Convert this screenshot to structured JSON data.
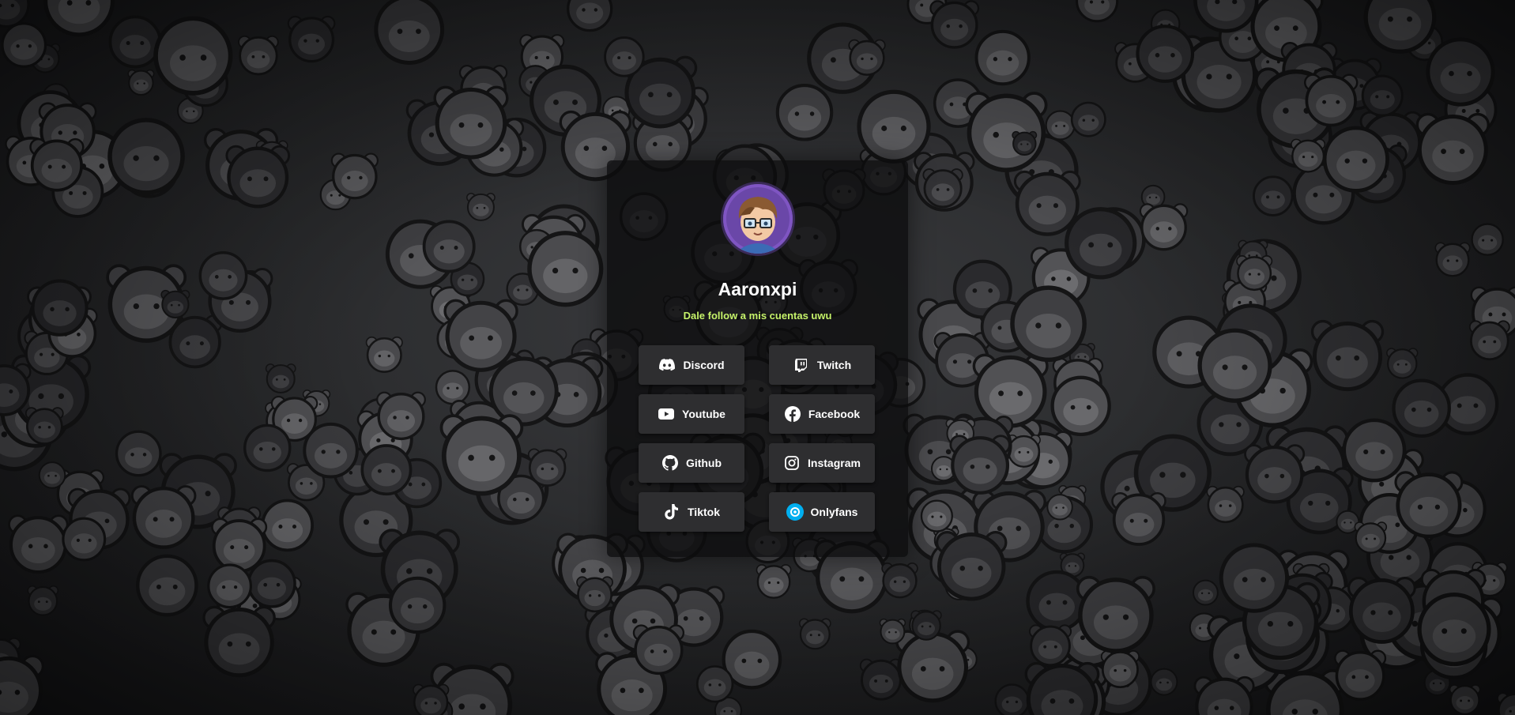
{
  "profile": {
    "name": "Aaronxpi",
    "tagline": "Dale follow a mis cuentas uwu",
    "avatar_icon": "avatar-cartoon-boy-glasses"
  },
  "links": [
    {
      "label": "Discord",
      "icon": "discord-icon"
    },
    {
      "label": "Twitch",
      "icon": "twitch-icon"
    },
    {
      "label": "Youtube",
      "icon": "youtube-icon"
    },
    {
      "label": "Facebook",
      "icon": "facebook-icon"
    },
    {
      "label": "Github",
      "icon": "github-icon"
    },
    {
      "label": "Instagram",
      "icon": "instagram-icon"
    },
    {
      "label": "Tiktok",
      "icon": "tiktok-icon"
    },
    {
      "label": "Onlyfans",
      "icon": "onlyfans-icon"
    }
  ],
  "colors": {
    "tagline": "#c6f36a",
    "button_bg": "#2e2e30",
    "card_bg": "#0c0c0d",
    "onlyfans_accent": "#00aff0"
  }
}
